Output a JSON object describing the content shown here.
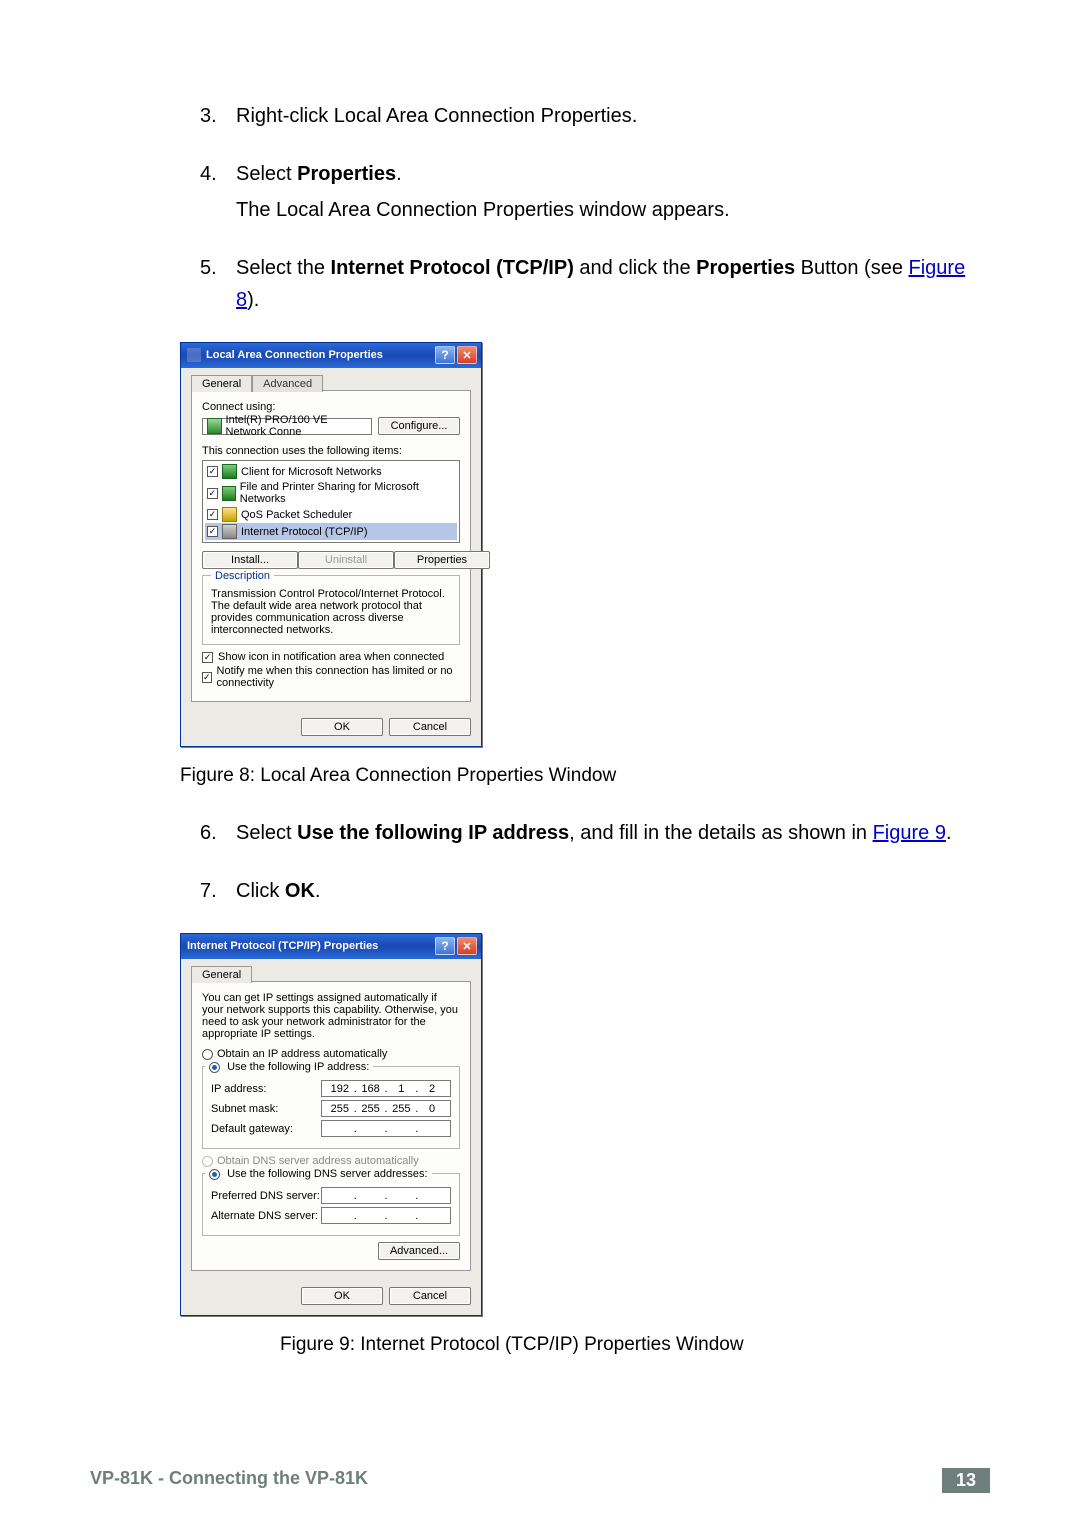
{
  "steps": {
    "s3": {
      "num": "3.",
      "text": "Right-click Local Area Connection Properties."
    },
    "s4": {
      "num": "4.",
      "lead": "Select ",
      "bold": "Properties",
      "tail": ".",
      "sub": "The Local Area Connection Properties window appears."
    },
    "s5": {
      "num": "5.",
      "a": "Select the ",
      "b": "Internet Protocol (TCP/IP)",
      "c": " and click the ",
      "d": "Properties",
      "e": " Button (see ",
      "link": "Figure 8",
      "f": ")."
    },
    "s6": {
      "num": "6.",
      "a": "Select ",
      "b": "Use the following IP address",
      "c": ", and fill in the details as shown in ",
      "link": "Figure 9",
      "d": "."
    },
    "s7": {
      "num": "7.",
      "a": "Click ",
      "b": "OK",
      "c": "."
    }
  },
  "fig8": {
    "caption": "Figure 8: Local Area Connection Properties Window"
  },
  "fig9": {
    "caption": "Figure 9: Internet Protocol (TCP/IP) Properties Window"
  },
  "dlg1": {
    "title": "Local Area Connection Properties",
    "tabs": {
      "general": "General",
      "advanced": "Advanced"
    },
    "connect_using_label": "Connect using:",
    "nic": "Intel(R) PRO/100 VE Network Conne",
    "configure": "Configure...",
    "uses_label": "This connection uses the following items:",
    "items": {
      "i1": "Client for Microsoft Networks",
      "i2": "File and Printer Sharing for Microsoft Networks",
      "i3": "QoS Packet Scheduler",
      "i4": "Internet Protocol (TCP/IP)"
    },
    "install": "Install...",
    "uninstall": "Uninstall",
    "properties": "Properties",
    "desc_title": "Description",
    "desc_text": "Transmission Control Protocol/Internet Protocol. The default wide area network protocol that provides communication across diverse interconnected networks.",
    "show_icon": "Show icon in notification area when connected",
    "notify": "Notify me when this connection has limited or no connectivity",
    "ok": "OK",
    "cancel": "Cancel",
    "check": "✓"
  },
  "dlg2": {
    "title": "Internet Protocol (TCP/IP) Properties",
    "tab_general": "General",
    "intro": "You can get IP settings assigned automatically if your network supports this capability. Otherwise, you need to ask your network administrator for the appropriate IP settings.",
    "r_auto": "Obtain an IP address automatically",
    "r_static": "Use the following IP address:",
    "ip_label": "IP address:",
    "ip": {
      "a": "192",
      "b": "168",
      "c": "1",
      "d": "2"
    },
    "subnet_label": "Subnet mask:",
    "sm": {
      "a": "255",
      "b": "255",
      "c": "255",
      "d": "0"
    },
    "gw_label": "Default gateway:",
    "r_dns_auto": "Obtain DNS server address automatically",
    "r_dns_static": "Use the following DNS server addresses:",
    "pdns": "Preferred DNS server:",
    "adns": "Alternate DNS server:",
    "advanced": "Advanced...",
    "ok": "OK",
    "cancel": "Cancel"
  },
  "footer": {
    "left": "VP-81K - Connecting the VP-81K",
    "page": "13"
  },
  "glyph": {
    "help": "?",
    "close": "✕",
    "dot": "."
  }
}
